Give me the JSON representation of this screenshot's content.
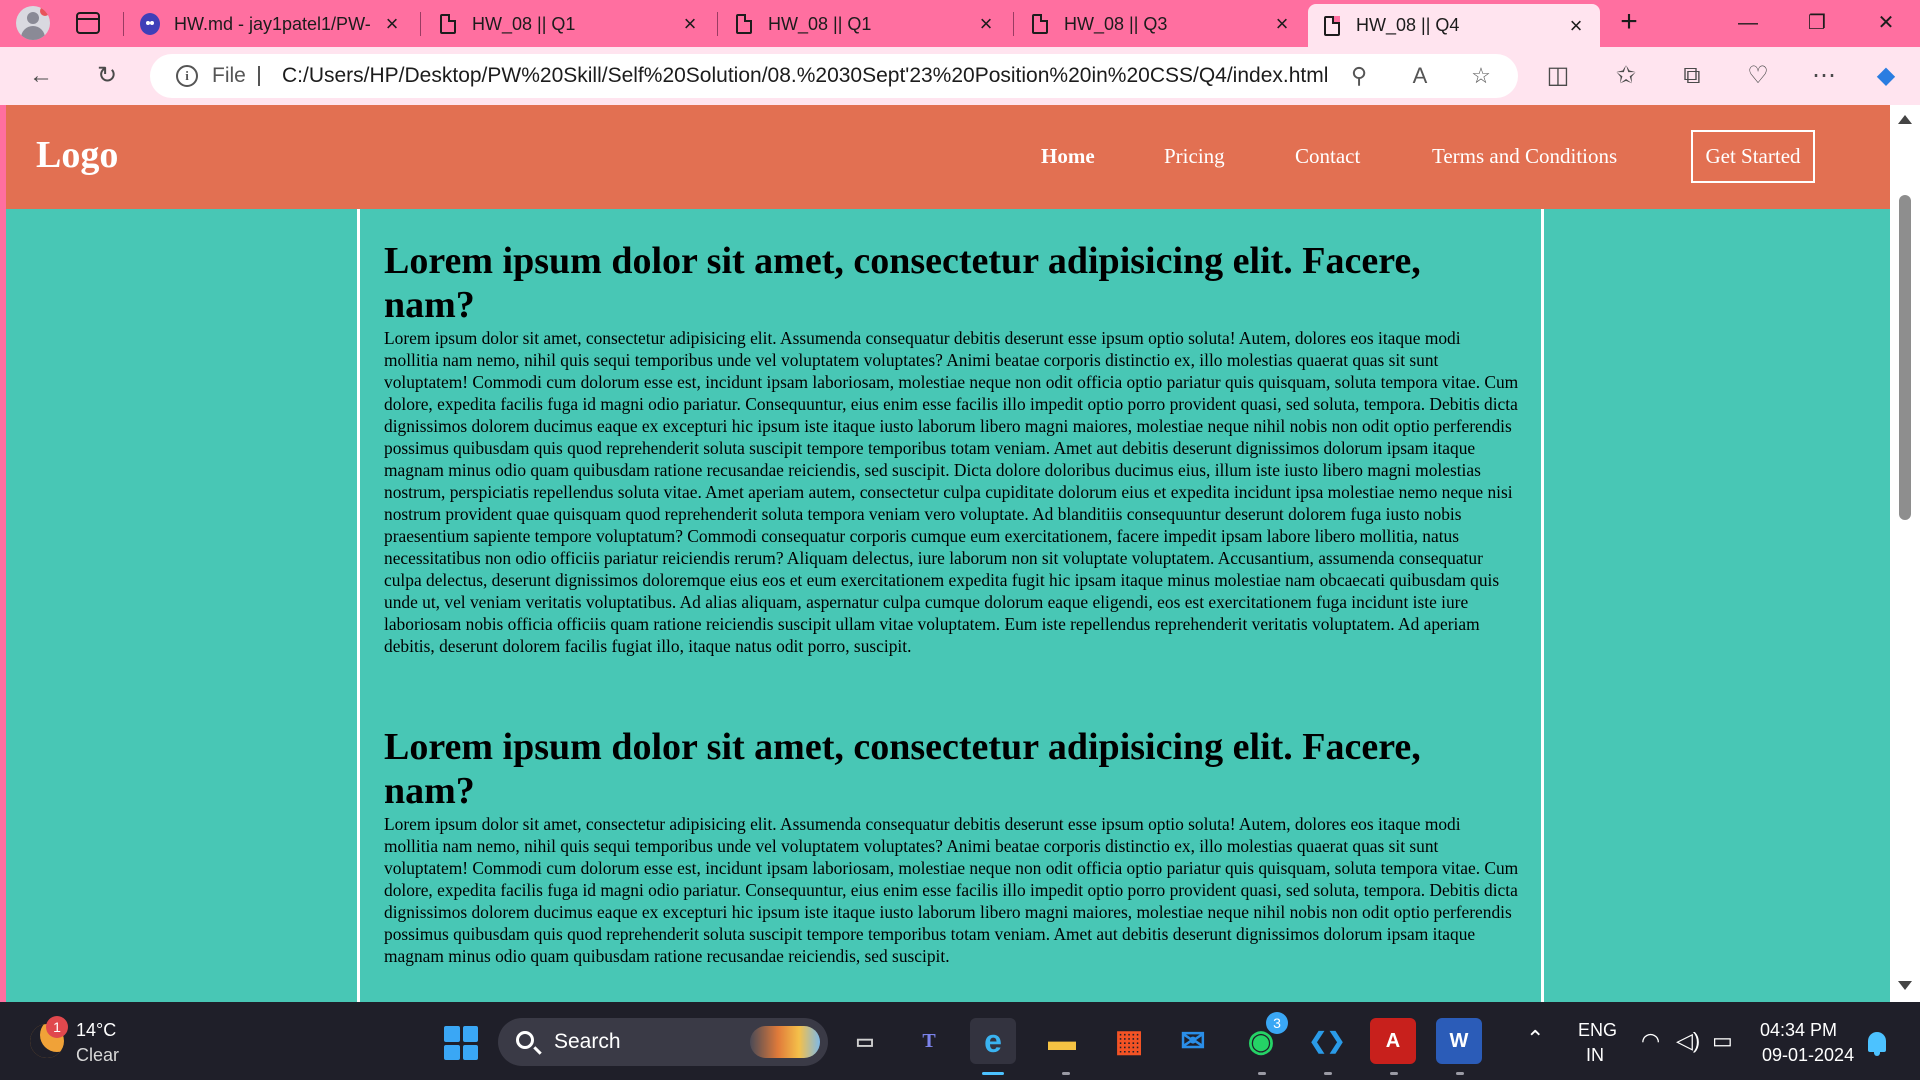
{
  "browser": {
    "tabs": [
      {
        "title": "HW.md - jay1patel1/PW-",
        "icon": "github-icon"
      },
      {
        "title": "HW_08 || Q1",
        "icon": "file-icon"
      },
      {
        "title": "HW_08 || Q1",
        "icon": "file-icon"
      },
      {
        "title": "HW_08 || Q3",
        "icon": "file-icon"
      },
      {
        "title": "HW_08 || Q4",
        "icon": "file-icon",
        "active": true
      }
    ],
    "address": {
      "scheme_label": "File",
      "url": "C:/Users/HP/Desktop/PW%20Skill/Self%20Solution/08.%2030Sept'23%20Position%20in%20CSS/Q4/index.html"
    }
  },
  "site": {
    "logo": "Logo",
    "nav": [
      "Home",
      "Pricing",
      "Contact",
      "Terms and Conditions"
    ],
    "cta": "Get Started",
    "articles": [
      {
        "heading": "Lorem ipsum dolor sit amet, consectetur adipisicing elit. Facere, nam?",
        "body": "Lorem ipsum dolor sit amet, consectetur adipisicing elit. Assumenda consequatur debitis deserunt esse ipsum optio soluta! Autem, dolores eos itaque modi mollitia nam nemo, nihil quis sequi temporibus unde vel voluptatem voluptates? Animi beatae corporis distinctio ex, illo molestias quaerat quas sit sunt voluptatem! Commodi cum dolorum esse est, incidunt ipsam laboriosam, molestiae neque non odit officia optio pariatur quis quisquam, soluta tempora vitae. Cum dolore, expedita facilis fuga id magni odio pariatur. Consequuntur, eius enim esse facilis illo impedit optio porro provident quasi, sed soluta, tempora. Debitis dicta dignissimos dolorem ducimus eaque ex excepturi hic ipsum iste itaque iusto laborum libero magni maiores, molestiae neque nihil nobis non odit optio perferendis possimus quibusdam quis quod reprehenderit soluta suscipit tempore temporibus totam veniam. Amet aut debitis deserunt dignissimos dolorum ipsam itaque magnam minus odio quam quibusdam ratione recusandae reiciendis, sed suscipit. Dicta dolore doloribus ducimus eius, illum iste iusto libero magni molestias nostrum, perspiciatis repellendus soluta vitae. Amet aperiam autem, consectetur culpa cupiditate dolorum eius et expedita incidunt ipsa molestiae nemo neque nisi nostrum provident quae quisquam quod reprehenderit soluta tempora veniam vero voluptate. Ad blanditiis consequuntur deserunt dolorem fuga iusto nobis praesentium sapiente tempore voluptatum? Commodi consequatur corporis cumque eum exercitationem, facere impedit ipsam labore libero mollitia, natus necessitatibus non odio officiis pariatur reiciendis rerum? Aliquam delectus, iure laborum non sit voluptate voluptatem. Accusantium, assumenda consequatur culpa delectus, deserunt dignissimos doloremque eius eos et eum exercitationem expedita fugit hic ipsam itaque minus molestiae nam obcaecati quibusdam quis unde ut, vel veniam veritatis voluptatibus. Ad alias aliquam, aspernatur culpa cumque dolorum eaque eligendi, eos est exercitationem fuga incidunt iste iure laboriosam nobis officia officiis quam ratione reiciendis suscipit ullam vitae voluptatem. Eum iste repellendus reprehenderit veritatis voluptatem. Ad aperiam debitis, deserunt dolorem facilis fugiat illo, itaque natus odit porro, suscipit."
      },
      {
        "heading": "Lorem ipsum dolor sit amet, consectetur adipisicing elit. Facere, nam?",
        "body": "Lorem ipsum dolor sit amet, consectetur adipisicing elit. Assumenda consequatur debitis deserunt esse ipsum optio soluta! Autem, dolores eos itaque modi mollitia nam nemo, nihil quis sequi temporibus unde vel voluptatem voluptates? Animi beatae corporis distinctio ex, illo molestias quaerat quas sit sunt voluptatem! Commodi cum dolorum esse est, incidunt ipsam laboriosam, molestiae neque non odit officia optio pariatur quis quisquam, soluta tempora vitae. Cum dolore, expedita facilis fuga id magni odio pariatur. Consequuntur, eius enim esse facilis illo impedit optio porro provident quasi, sed soluta, tempora. Debitis dicta dignissimos dolorem ducimus eaque ex excepturi hic ipsum iste itaque iusto laborum libero magni maiores, molestiae neque nihil nobis non odit optio perferendis possimus quibusdam quis quod reprehenderit soluta suscipit tempore temporibus totam veniam. Amet aut debitis deserunt dignissimos dolorum ipsam itaque magnam minus odio quam quibusdam ratione recusandae reiciendis, sed suscipit."
      }
    ]
  },
  "taskbar": {
    "weather": {
      "temp": "14°C",
      "desc": "Clear",
      "badge": "1"
    },
    "search_label": "Search",
    "apps": [
      {
        "name": "task-view",
        "glyph": "▭"
      },
      {
        "name": "teams",
        "glyph": "T"
      },
      {
        "name": "edge",
        "glyph": "e",
        "active": true
      },
      {
        "name": "file-explorer",
        "glyph": "▬"
      },
      {
        "name": "store",
        "glyph": "▦"
      },
      {
        "name": "mail",
        "glyph": "✉"
      },
      {
        "name": "whatsapp",
        "glyph": "◉",
        "badge": "3"
      },
      {
        "name": "vscode",
        "glyph": "❮❯"
      },
      {
        "name": "acrobat",
        "glyph": "A"
      },
      {
        "name": "word",
        "glyph": "W"
      }
    ],
    "lang": "ENG",
    "region": "IN",
    "time": "04:34 PM",
    "date": "09-01-2024"
  },
  "colors": {
    "browser_frame": "#ff6fa0",
    "navbar": "#e27052",
    "page_bg": "#48c7b5",
    "taskbar": "#1f1f29"
  }
}
